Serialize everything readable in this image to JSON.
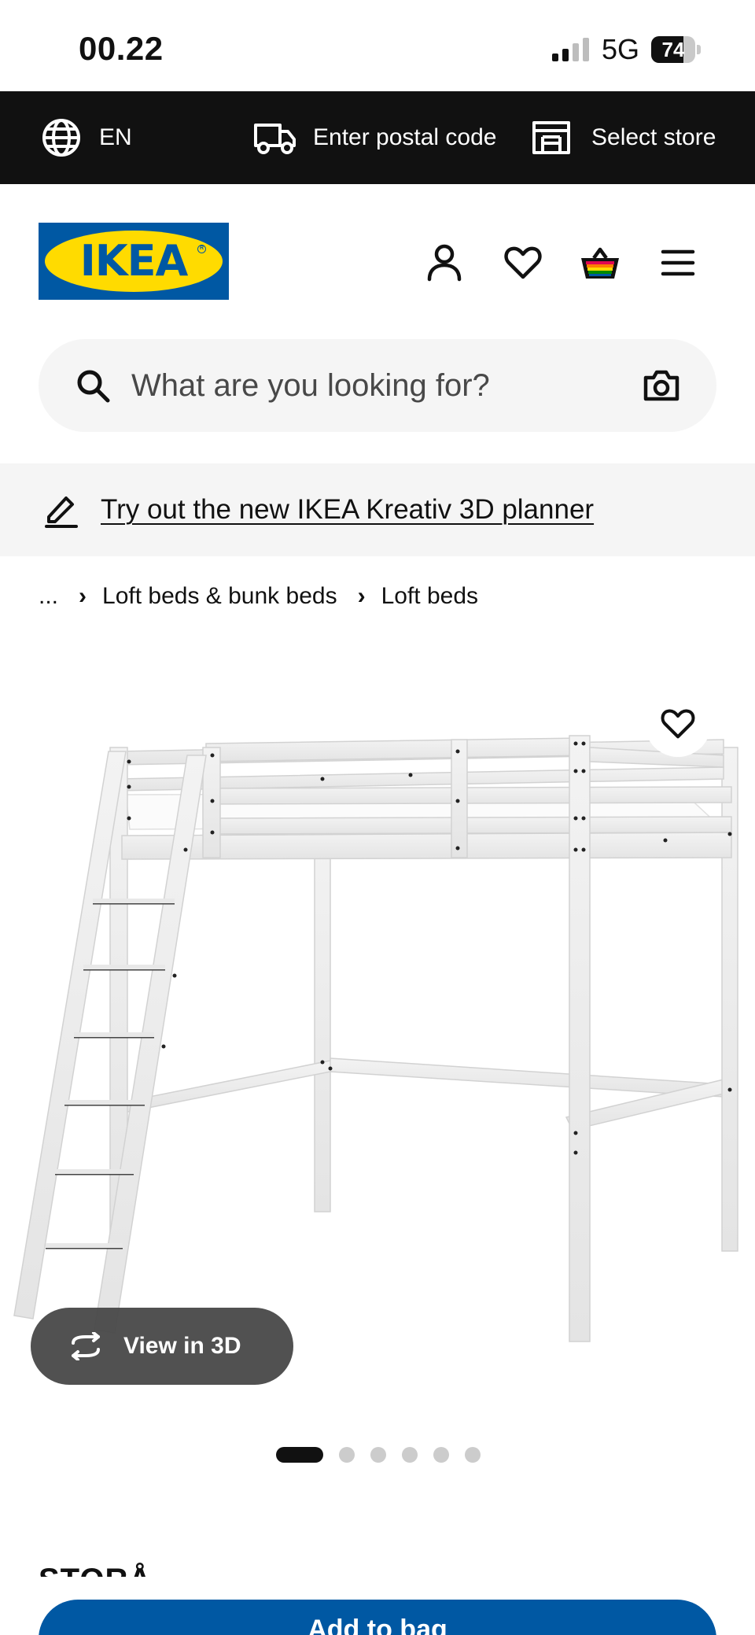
{
  "status_bar": {
    "time": "00.22",
    "network": "5G",
    "battery": "74",
    "battery_level": 0.74
  },
  "top_bar": {
    "language": "EN",
    "postal_code": "Enter postal code",
    "store": "Select store",
    "icons": [
      "globe-icon",
      "truck-icon",
      "store-icon"
    ]
  },
  "header": {
    "logo_text": "IKEA",
    "icons": [
      "profile-icon",
      "heart-icon",
      "shopping-bag-icon",
      "menu-icon"
    ],
    "brand_colors": {
      "blue": "#0058a3",
      "yellow": "#ffdb00"
    }
  },
  "search": {
    "placeholder": "What are you looking for?",
    "icons": [
      "search-icon",
      "camera-icon"
    ]
  },
  "planner": {
    "link_text": "Try out the new IKEA Kreativ 3D planner",
    "icon": "pencil-icon"
  },
  "breadcrumb": {
    "ellipsis": "...",
    "items": [
      "Loft beds & bunk beds",
      "Loft beds"
    ]
  },
  "product": {
    "view_3d_label": "View in 3D",
    "gallery_count": 6,
    "gallery_active": 1,
    "title_partial": "STORÅ",
    "add_button_partial": "Add to bag",
    "accent": "#0058a3"
  }
}
